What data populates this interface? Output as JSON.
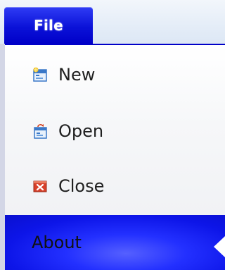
{
  "ribbon": {
    "file_tab_label": "File"
  },
  "menu": {
    "items": [
      {
        "label": "New",
        "icon": "new-document-icon"
      },
      {
        "label": "Open",
        "icon": "open-folder-icon"
      },
      {
        "label": "Close",
        "icon": "close-icon"
      }
    ],
    "about": {
      "label": "About",
      "selected": true
    }
  },
  "colors": {
    "tab_accent": "#0000c8",
    "selected_accent": "#1a22ff"
  }
}
